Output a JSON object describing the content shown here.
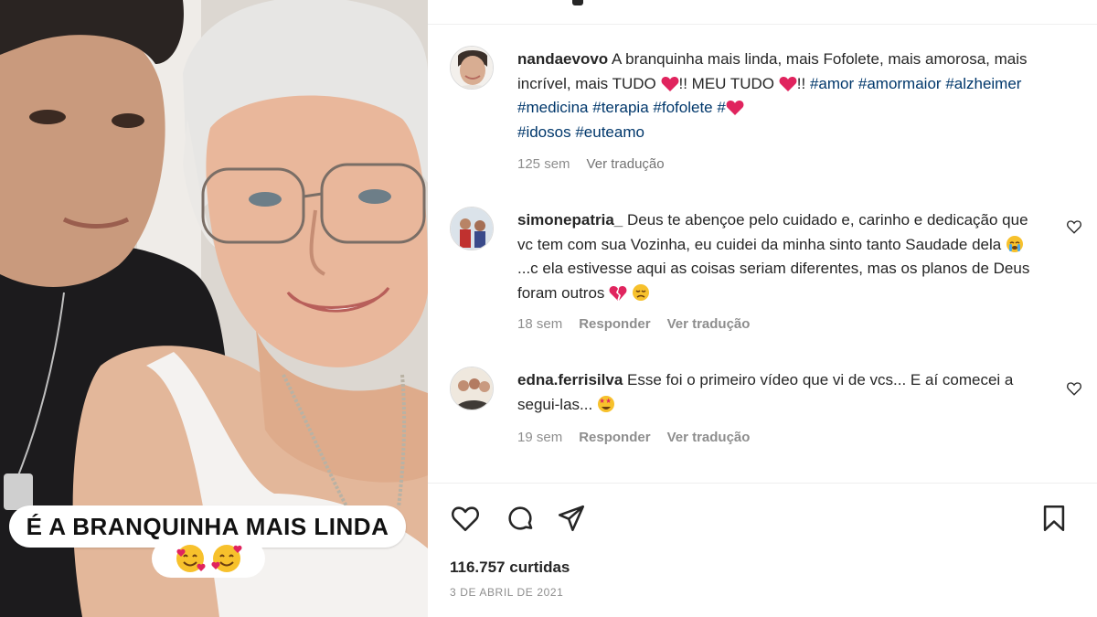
{
  "media": {
    "sticker_text": "É A BRANQUINHA MAIS LINDA",
    "sticker_emojis": [
      "smiling-face-with-hearts",
      "smiling-face-with-hearts"
    ]
  },
  "caption": {
    "username": "nandaevovo",
    "text_part1": "A branquinha mais linda, mais Fofolete, mais amorosa, mais incrível, mais TUDO",
    "text_part2": "!! MEU TUDO",
    "text_part3": "!!",
    "hashtags": [
      "#amor",
      "#amormaior",
      "#alzheimer",
      "#medicina",
      "#terapia",
      "#fofolete",
      "#",
      "#idosos",
      "#euteamo"
    ],
    "time": "125 sem",
    "translate": "Ver tradução"
  },
  "comments": [
    {
      "username": "simonepatria_",
      "text_a": "Deus te abençoe pelo cuidado e, carinho e dedicação que vc tem com sua Vozinha, eu cuidei da minha sinto tanto Saudade dela",
      "text_b": "...c ela estivesse aqui as coisas seriam diferentes, mas os planos de Deus foram outros",
      "time": "18 sem",
      "reply": "Responder",
      "translate": "Ver tradução"
    },
    {
      "username": "edna.ferrisilva",
      "text_a": "Esse foi o primeiro vídeo que vi de vcs... E aí comecei a segui-las...",
      "time": "19 sem",
      "reply": "Responder",
      "translate": "Ver tradução"
    }
  ],
  "actions": {
    "icons": [
      "heart-outline-icon",
      "comment-icon",
      "share-icon",
      "bookmark-icon"
    ]
  },
  "likes": "116.757 curtidas",
  "date": "3 DE ABRIL DE 2021",
  "colors": {
    "link": "#00376b",
    "muted": "#8e8e8e",
    "text": "#262626",
    "heart_emoji": "#e0245e"
  }
}
